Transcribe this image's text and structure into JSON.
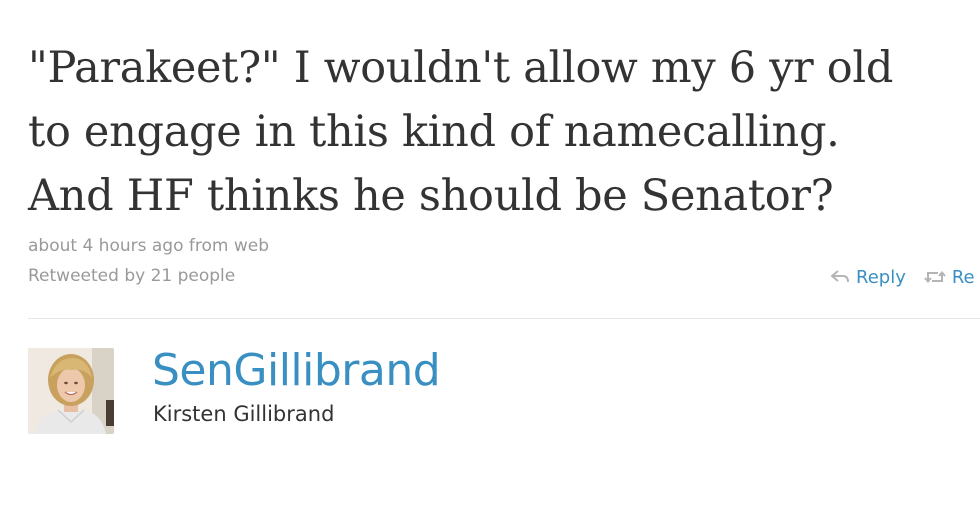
{
  "tweet": {
    "lines": [
      "\"Parakeet?\" I wouldn't allow my 6 yr old",
      "to engage in this kind of namecalling.",
      "And HF thinks he should be Senator?"
    ],
    "timestamp": "about 4 hours ago from web",
    "retweeted_by": "Retweeted by 21 people"
  },
  "actions": {
    "reply_label": "Reply",
    "retweet_label": "Re"
  },
  "author": {
    "screen_name": "SenGillibrand",
    "full_name": "Kirsten Gillibrand"
  },
  "colors": {
    "link": "#3a8fc2",
    "text": "#333333",
    "meta": "#999999",
    "divider": "#e6e6e6"
  },
  "icons": {
    "reply": "reply-arrow-icon",
    "retweet": "retweet-icon"
  }
}
